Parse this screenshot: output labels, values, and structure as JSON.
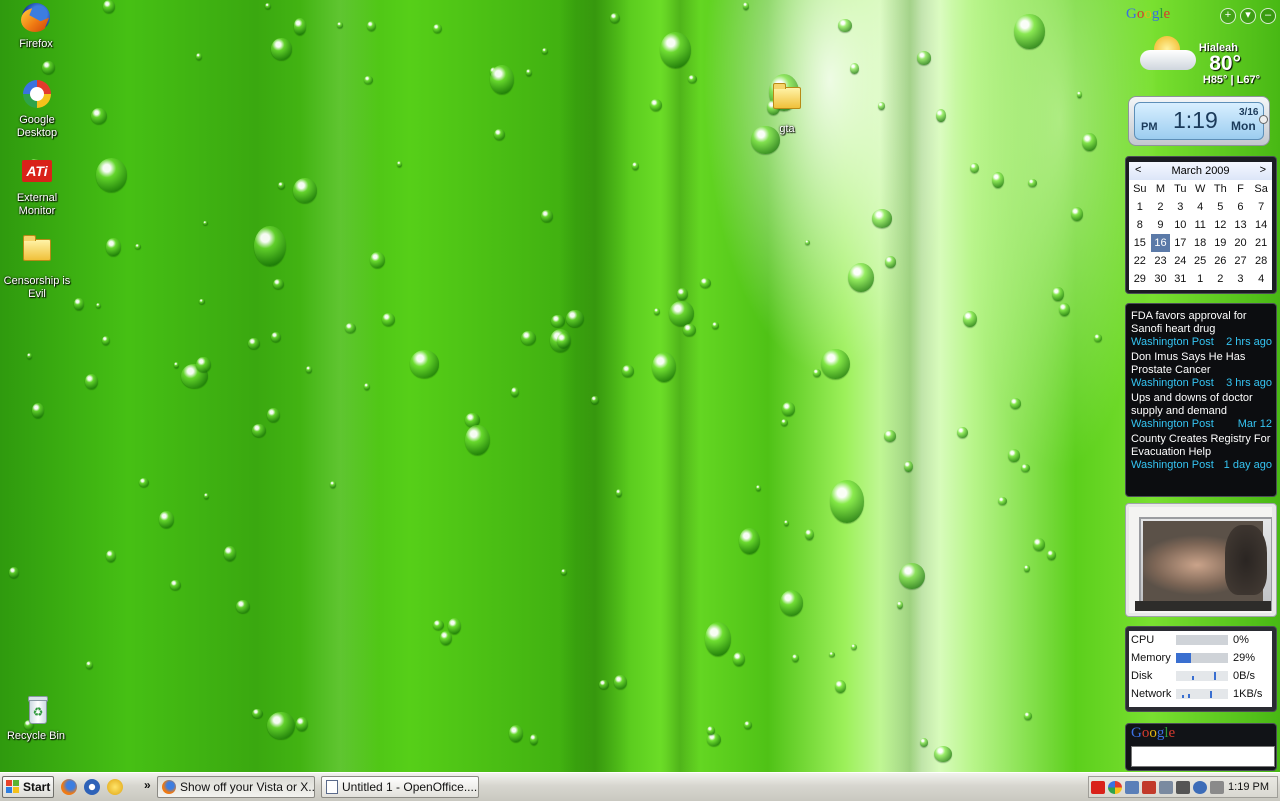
{
  "desktop": {
    "icons": [
      {
        "label": "Firefox"
      },
      {
        "label": "Google Desktop"
      },
      {
        "label": "External Monitor",
        "badge": "ATi"
      },
      {
        "label": "Censorship is Evil"
      },
      {
        "label": "gta"
      },
      {
        "label": "Recycle Bin"
      }
    ]
  },
  "sidebar": {
    "logo": {
      "letters": [
        "G",
        "o",
        "o",
        "g",
        "l",
        "e"
      ]
    },
    "controls": {
      "add": "+",
      "menu": "▾",
      "minimize": "–"
    },
    "weather": {
      "city": "Hialeah",
      "temp": "80°",
      "high_low": "H85° | L67°"
    },
    "clock": {
      "ampm": "PM",
      "time": "1:19",
      "date": "3/16",
      "day": "Mon"
    },
    "calendar": {
      "prev": "<",
      "next": ">",
      "month": "March 2009",
      "weekdays": [
        "Su",
        "M",
        "Tu",
        "W",
        "Th",
        "F",
        "Sa"
      ],
      "weeks": [
        [
          "1",
          "2",
          "3",
          "4",
          "5",
          "6",
          "7"
        ],
        [
          "8",
          "9",
          "10",
          "11",
          "12",
          "13",
          "14"
        ],
        [
          "15",
          "16",
          "17",
          "18",
          "19",
          "20",
          "21"
        ],
        [
          "22",
          "23",
          "24",
          "25",
          "26",
          "27",
          "28"
        ],
        [
          "29",
          "30",
          "31",
          "1",
          "2",
          "3",
          "4"
        ]
      ],
      "today": "16"
    },
    "news": [
      {
        "title": "FDA favors approval for Sanofi heart drug",
        "source": "Washington Post",
        "time": "2 hrs ago"
      },
      {
        "title": "Don Imus Says He Has Prostate Cancer",
        "source": "Washington Post",
        "time": "3 hrs ago"
      },
      {
        "title": "Ups and downs of doctor supply and demand",
        "source": "Washington Post",
        "time": "Mar 12"
      },
      {
        "title": "County Creates Registry For Evacuation Help",
        "source": "Washington Post",
        "time": "1 day ago"
      }
    ],
    "meter": {
      "rows": [
        {
          "label": "CPU",
          "value": "0%",
          "fraction": 0.0
        },
        {
          "label": "Memory",
          "value": "29%",
          "fraction": 0.29
        },
        {
          "label": "Disk",
          "value": "0B/s",
          "fraction": 0.0
        },
        {
          "label": "Network",
          "value": "1KB/s",
          "fraction": 0.02
        }
      ],
      "accent": "#3a6fd0"
    },
    "search": {
      "logo": "Google",
      "value": ""
    }
  },
  "taskbar": {
    "start": "Start",
    "overflow": "»",
    "tasks": [
      {
        "label": "Show off your Vista or X..."
      },
      {
        "label": "Untitled 1 - OpenOffice...."
      }
    ],
    "clock": "1:19 PM"
  },
  "colors": {
    "news_meta": "#35c4f2",
    "calendar_today": "#5b7aa8",
    "wallpaper": "#46c014"
  }
}
